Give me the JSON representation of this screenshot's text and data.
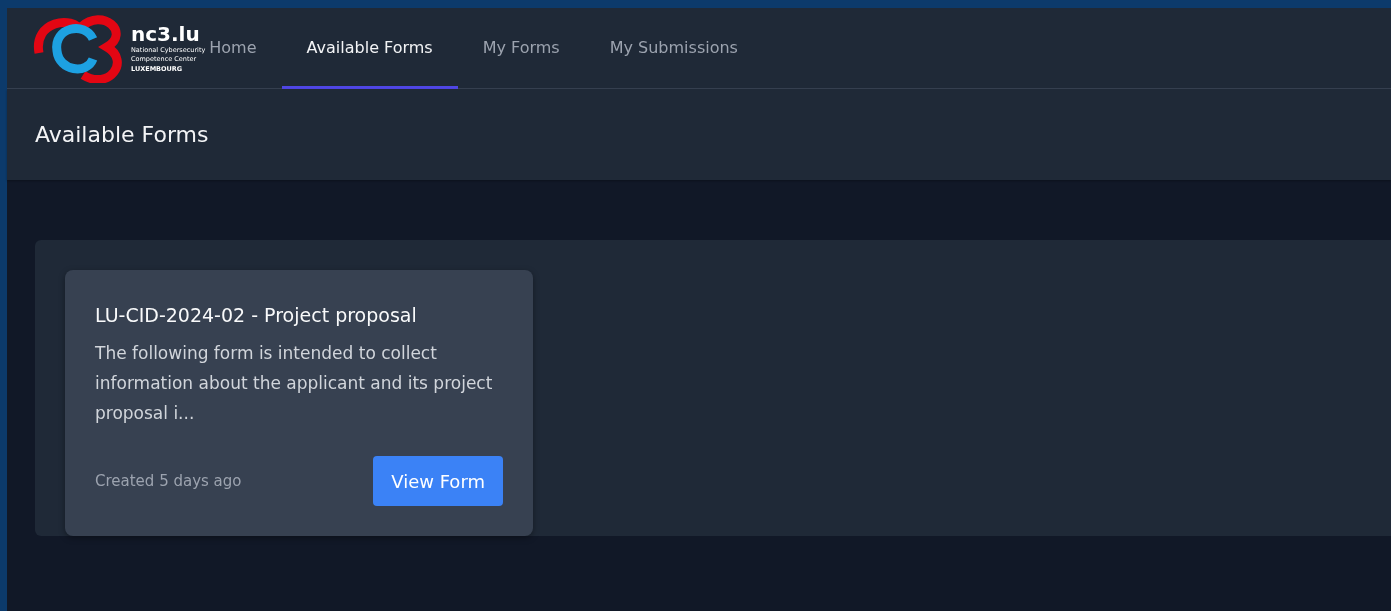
{
  "logo": {
    "name": "nc3.lu",
    "subtitle_lines": [
      "National Cybersecurity",
      "Competence Center"
    ],
    "country": "LUXEMBOURG"
  },
  "nav": [
    {
      "label": "Home",
      "selected": false
    },
    {
      "label": "Available Forms",
      "selected": true
    },
    {
      "label": "My Forms",
      "selected": false
    },
    {
      "label": "My Submissions",
      "selected": false
    }
  ],
  "page_title": "Available Forms",
  "forms": [
    {
      "title": "LU-CID-2024-02 - Project proposal",
      "description": "The following form is intended to collect information about the applicant and its project proposal i...",
      "created": "Created 5 days ago",
      "button": "View Form"
    }
  ]
}
